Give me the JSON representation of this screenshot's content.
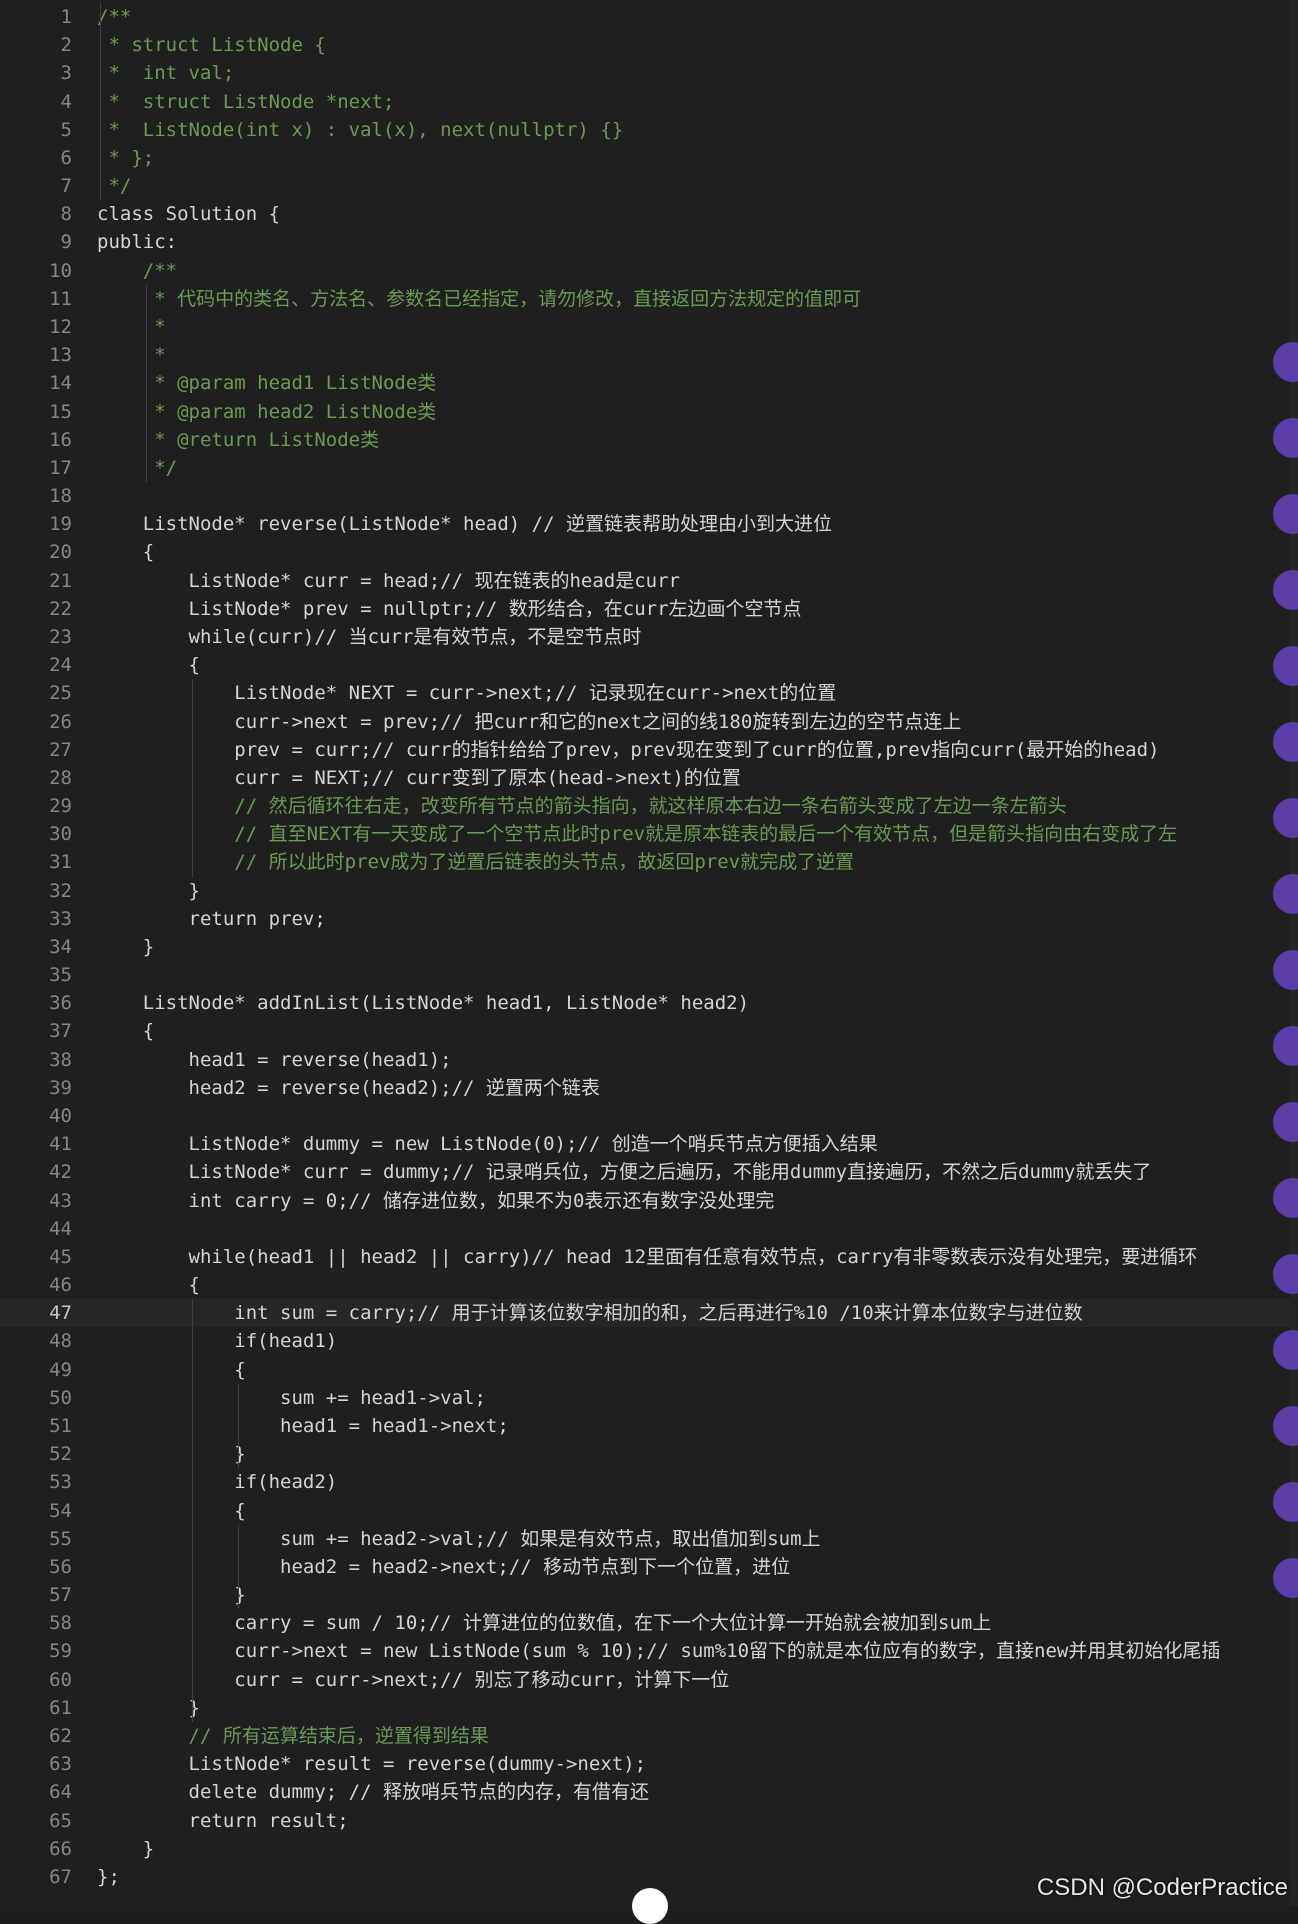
{
  "editor": {
    "active_line": 47,
    "lines": [
      {
        "n": "1",
        "text": "/**"
      },
      {
        "n": "2",
        "text": " * struct ListNode {"
      },
      {
        "n": "3",
        "text": " *  int val;"
      },
      {
        "n": "4",
        "text": " *  struct ListNode *next;"
      },
      {
        "n": "5",
        "text": " *  ListNode(int x) : val(x), next(nullptr) {}"
      },
      {
        "n": "6",
        "text": " * };"
      },
      {
        "n": "7",
        "text": " */"
      },
      {
        "n": "8",
        "text": "class Solution {"
      },
      {
        "n": "9",
        "text": "public:"
      },
      {
        "n": "10",
        "text": "    /**"
      },
      {
        "n": "11",
        "text": "     * 代码中的类名、方法名、参数名已经指定，请勿修改，直接返回方法规定的值即可"
      },
      {
        "n": "12",
        "text": "     *"
      },
      {
        "n": "13",
        "text": "     *"
      },
      {
        "n": "14",
        "text": "     * @param head1 ListNode类"
      },
      {
        "n": "15",
        "text": "     * @param head2 ListNode类"
      },
      {
        "n": "16",
        "text": "     * @return ListNode类"
      },
      {
        "n": "17",
        "text": "     */"
      },
      {
        "n": "18",
        "text": ""
      },
      {
        "n": "19",
        "text": "    ListNode* reverse(ListNode* head) // 逆置链表帮助处理由小到大进位"
      },
      {
        "n": "20",
        "text": "    {"
      },
      {
        "n": "21",
        "text": "        ListNode* curr = head;// 现在链表的head是curr"
      },
      {
        "n": "22",
        "text": "        ListNode* prev = nullptr;// 数形结合，在curr左边画个空节点"
      },
      {
        "n": "23",
        "text": "        while(curr)// 当curr是有效节点，不是空节点时"
      },
      {
        "n": "24",
        "text": "        {"
      },
      {
        "n": "25",
        "text": "            ListNode* NEXT = curr->next;// 记录现在curr->next的位置"
      },
      {
        "n": "26",
        "text": "            curr->next = prev;// 把curr和它的next之间的线180旋转到左边的空节点连上"
      },
      {
        "n": "27",
        "text": "            prev = curr;// curr的指针给给了prev，prev现在变到了curr的位置,prev指向curr(最开始的head)"
      },
      {
        "n": "28",
        "text": "            curr = NEXT;// curr变到了原本(head->next)的位置"
      },
      {
        "n": "29",
        "text": "            // 然后循环往右走，改变所有节点的箭头指向，就这样原本右边一条右箭头变成了左边一条左箭头"
      },
      {
        "n": "30",
        "text": "            // 直至NEXT有一天变成了一个空节点此时prev就是原本链表的最后一个有效节点，但是箭头指向由右变成了左"
      },
      {
        "n": "31",
        "text": "            // 所以此时prev成为了逆置后链表的头节点，故返回prev就完成了逆置"
      },
      {
        "n": "32",
        "text": "        }"
      },
      {
        "n": "33",
        "text": "        return prev;"
      },
      {
        "n": "34",
        "text": "    }"
      },
      {
        "n": "35",
        "text": ""
      },
      {
        "n": "36",
        "text": "    ListNode* addInList(ListNode* head1, ListNode* head2)"
      },
      {
        "n": "37",
        "text": "    {"
      },
      {
        "n": "38",
        "text": "        head1 = reverse(head1);"
      },
      {
        "n": "39",
        "text": "        head2 = reverse(head2);// 逆置两个链表"
      },
      {
        "n": "40",
        "text": ""
      },
      {
        "n": "41",
        "text": "        ListNode* dummy = new ListNode(0);// 创造一个哨兵节点方便插入结果"
      },
      {
        "n": "42",
        "text": "        ListNode* curr = dummy;// 记录哨兵位，方便之后遍历，不能用dummy直接遍历，不然之后dummy就丢失了"
      },
      {
        "n": "43",
        "text": "        int carry = 0;// 储存进位数，如果不为0表示还有数字没处理完"
      },
      {
        "n": "44",
        "text": ""
      },
      {
        "n": "45",
        "text": "        while(head1 || head2 || carry)// head 12里面有任意有效节点，carry有非零数表示没有处理完，要进循环"
      },
      {
        "n": "46",
        "text": "        {"
      },
      {
        "n": "47",
        "text": "            int sum = carry;// 用于计算该位数字相加的和，之后再进行%10 /10来计算本位数字与进位数"
      },
      {
        "n": "48",
        "text": "            if(head1)"
      },
      {
        "n": "49",
        "text": "            {"
      },
      {
        "n": "50",
        "text": "                sum += head1->val;"
      },
      {
        "n": "51",
        "text": "                head1 = head1->next;"
      },
      {
        "n": "52",
        "text": "            }"
      },
      {
        "n": "53",
        "text": "            if(head2)"
      },
      {
        "n": "54",
        "text": "            {"
      },
      {
        "n": "55",
        "text": "                sum += head2->val;// 如果是有效节点，取出值加到sum上"
      },
      {
        "n": "56",
        "text": "                head2 = head2->next;// 移动节点到下一个位置，进位"
      },
      {
        "n": "57",
        "text": "            }"
      },
      {
        "n": "58",
        "text": "            carry = sum / 10;// 计算进位的位数值，在下一个大位计算一开始就会被加到sum上"
      },
      {
        "n": "59",
        "text": "            curr->next = new ListNode(sum % 10);// sum%10留下的就是本位应有的数字，直接new并用其初始化尾插"
      },
      {
        "n": "60",
        "text": "            curr = curr->next;// 别忘了移动curr，计算下一位"
      },
      {
        "n": "61",
        "text": "        }"
      },
      {
        "n": "62",
        "text": "        // 所有运算结束后，逆置得到结果"
      },
      {
        "n": "63",
        "text": "        ListNode* result = reverse(dummy->next);"
      },
      {
        "n": "64",
        "text": "        delete dummy; // 释放哨兵节点的内存，有借有还"
      },
      {
        "n": "65",
        "text": "        return result;"
      },
      {
        "n": "66",
        "text": "    }"
      },
      {
        "n": "67",
        "text": "};"
      }
    ]
  },
  "watermark": "CSDN @CoderPractice",
  "colors": {
    "background": "#1f1f1f",
    "line_number": "#858585",
    "scroll_marker": "#5b3fa6"
  }
}
